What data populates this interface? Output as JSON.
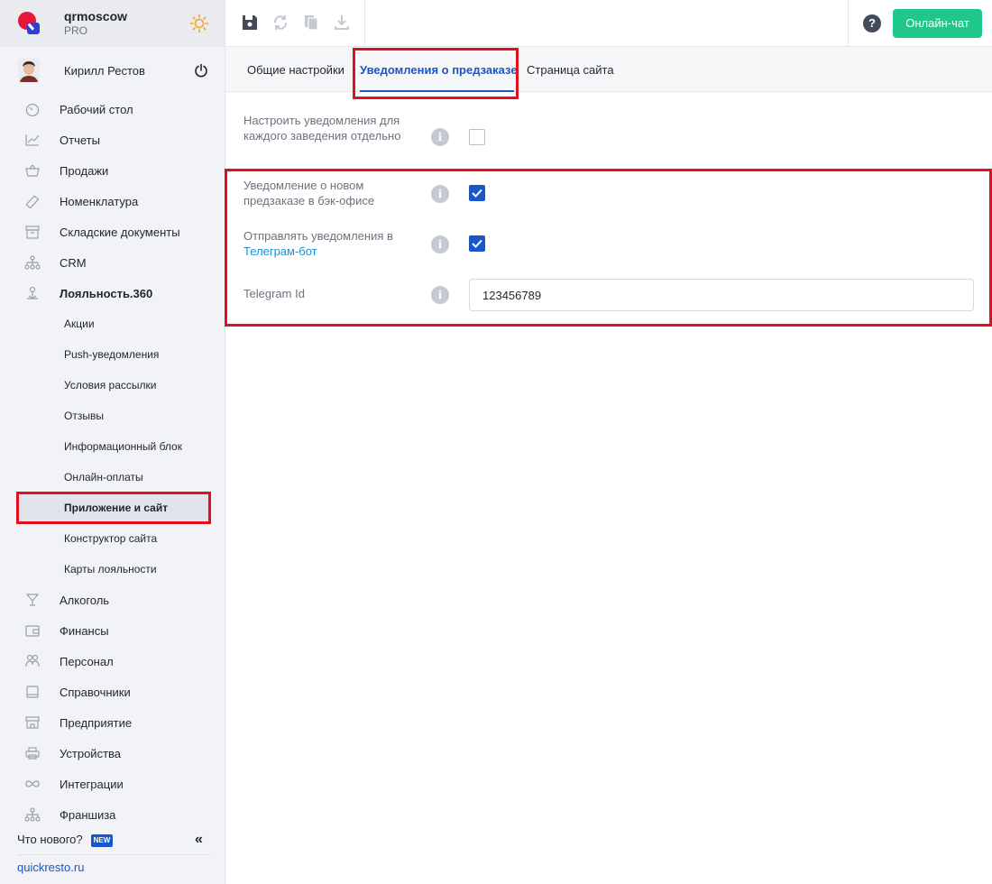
{
  "brand": {
    "name": "qrmoscow",
    "plan": "PRO"
  },
  "user": {
    "name": "Кирилл Рестов"
  },
  "nav": {
    "items": [
      {
        "label": "Рабочий стол",
        "icon": "gauge-icon"
      },
      {
        "label": "Отчеты",
        "icon": "chart-icon"
      },
      {
        "label": "Продажи",
        "icon": "basket-icon"
      },
      {
        "label": "Номенклатура",
        "icon": "tag-icon"
      },
      {
        "label": "Складские документы",
        "icon": "archive-icon"
      },
      {
        "label": "CRM",
        "icon": "hierarchy-icon"
      },
      {
        "label": "Лояльность.360",
        "icon": "loyalty-icon"
      }
    ],
    "loyalty_sub": [
      {
        "label": "Акции"
      },
      {
        "label": "Push-уведомления"
      },
      {
        "label": "Условия рассылки"
      },
      {
        "label": "Отзывы"
      },
      {
        "label": "Информационный блок"
      },
      {
        "label": "Онлайн-оплаты"
      },
      {
        "label": "Приложение и сайт"
      },
      {
        "label": "Конструктор сайта"
      },
      {
        "label": "Карты лояльности"
      }
    ],
    "items_after": [
      {
        "label": "Алкоголь",
        "icon": "cocktail-icon"
      },
      {
        "label": "Финансы",
        "icon": "wallet-icon"
      },
      {
        "label": "Персонал",
        "icon": "people-icon"
      },
      {
        "label": "Справочники",
        "icon": "book-icon"
      },
      {
        "label": "Предприятие",
        "icon": "store-icon"
      },
      {
        "label": "Устройства",
        "icon": "printer-icon"
      },
      {
        "label": "Интеграции",
        "icon": "infinity-icon"
      },
      {
        "label": "Франшиза",
        "icon": "franchise-icon"
      }
    ]
  },
  "footer": {
    "whats_new": "Что нового?",
    "new_badge": "NEW",
    "site": "quickresto.ru"
  },
  "topbar": {
    "chat_label": "Онлайн-чат",
    "help": "?"
  },
  "tabs": [
    {
      "label": "Общие настройки"
    },
    {
      "label": "Уведомления о предзаказе"
    },
    {
      "label": "Страница сайта"
    }
  ],
  "form": {
    "per_venue": {
      "label": "Настроить уведомления для каждого заведения отдельно",
      "checked": false
    },
    "backoffice": {
      "label": "Уведомление о новом предзаказе в бэк-офисе",
      "checked": true
    },
    "telegram": {
      "label_prefix": "Отправлять уведомления в ",
      "label_link": "Телеграм-бот",
      "checked": true
    },
    "telegram_id": {
      "label": "Telegram Id",
      "value": "123456789"
    }
  },
  "colors": {
    "accent": "#1a56c8",
    "chat": "#21c68b",
    "highlight": "#e0101e"
  }
}
